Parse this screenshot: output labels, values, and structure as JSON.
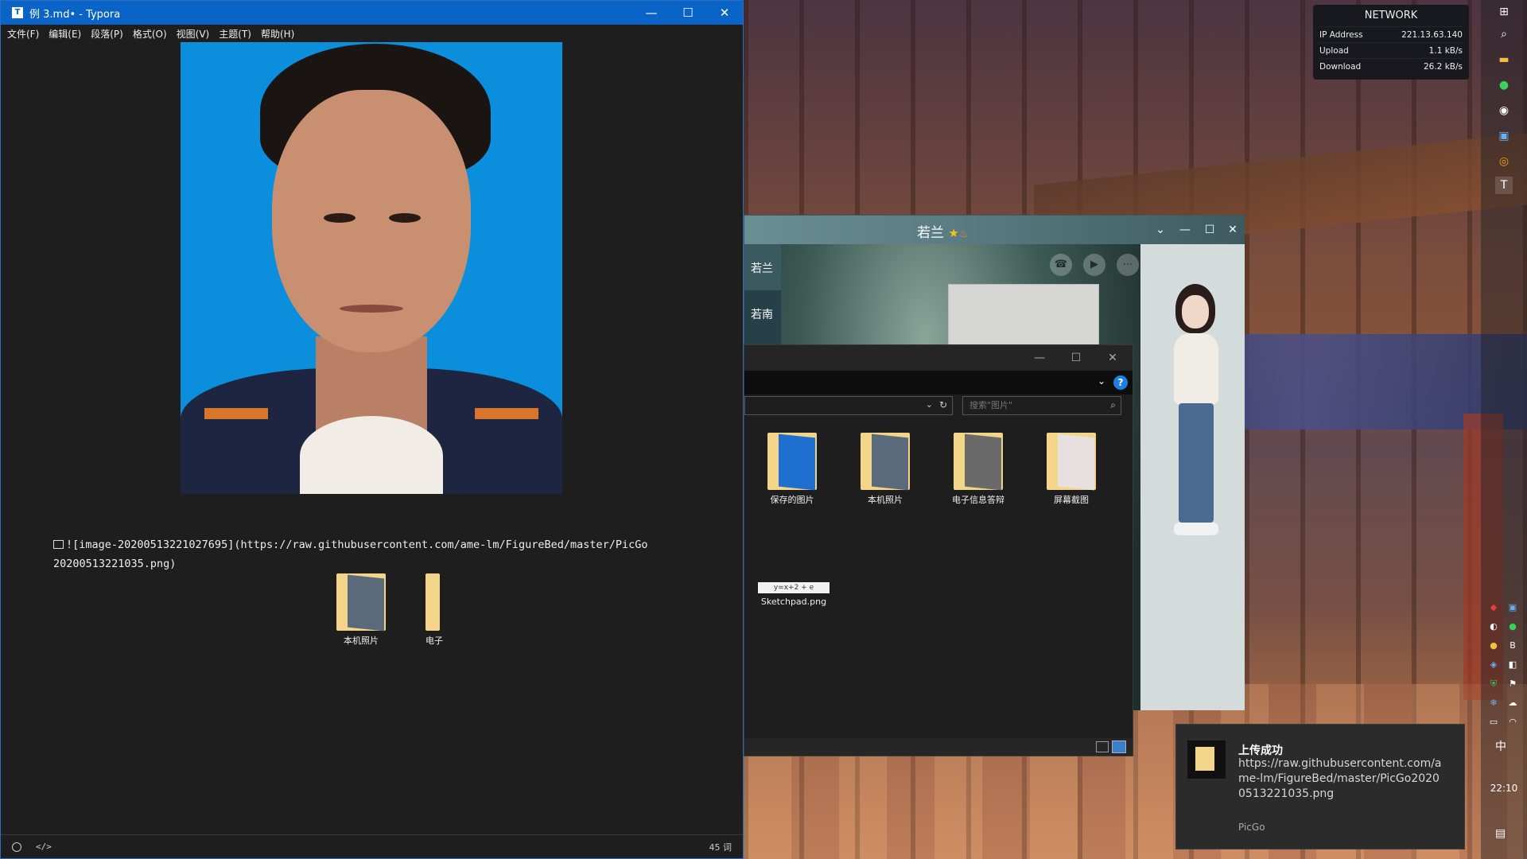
{
  "typora": {
    "title": "例 3.md• - Typora",
    "menu": [
      "文件(F)",
      "编辑(E)",
      "段落(P)",
      "格式(O)",
      "视图(V)",
      "主题(T)",
      "帮助(H)"
    ],
    "markdown_line1": "![image-20200513221027695](https://raw.githubusercontent.com/ame-lm/FigureBed/master/PicGo",
    "markdown_line2": "20200513221035.png)",
    "folders": [
      "本机照片",
      "电子"
    ],
    "word_count": "45 词"
  },
  "chat": {
    "title": "若兰",
    "sidebar": [
      "若兰",
      "若南"
    ]
  },
  "explorer": {
    "search_placeholder": "搜索\"图片\"",
    "folders": [
      "保存的图片",
      "本机照片",
      "电子信息答辩",
      "屏幕截图"
    ],
    "file": "Sketchpad.png",
    "file_thumb_text": "y=x+2 + e"
  },
  "network": {
    "heading": "NETWORK",
    "rows": [
      {
        "label": "IP Address",
        "value": "221.13.63.140"
      },
      {
        "label": "Upload",
        "value": "1.1 kB/s"
      },
      {
        "label": "Download",
        "value": "26.2 kB/s"
      }
    ]
  },
  "taskbar": {
    "language": "中",
    "time": "22:10"
  },
  "toast": {
    "title": "上传成功",
    "body": "https://raw.githubusercontent.com/ame-lm/FigureBed/master/PicGo20200513221035.png",
    "app": "PicGo"
  },
  "colors": {
    "typora_titlebar": "#0a63c7",
    "photo_background": "#0b8fdd",
    "folder_yellow": "#f3d58a",
    "help_blue": "#1f7fe0"
  }
}
